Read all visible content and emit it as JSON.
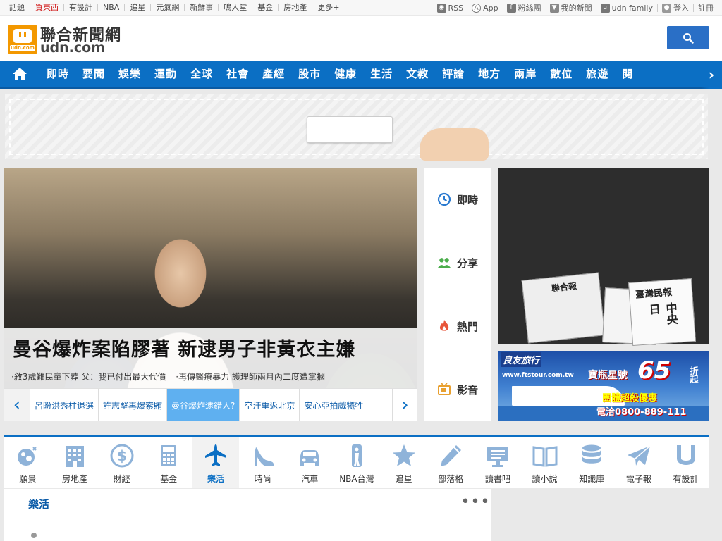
{
  "topbar": {
    "links": [
      "話題",
      "買東西",
      "有設計",
      "NBA",
      "追星",
      "元氣網",
      "新鮮事",
      "鳴人堂",
      "基金",
      "房地產",
      "更多+"
    ],
    "hot_index": 1,
    "tools": {
      "rss": "RSS",
      "app": "App",
      "fans": "粉絲團",
      "mynews": "我的新聞",
      "family": "udn family",
      "login": "登入",
      "register": "註冊"
    }
  },
  "header": {
    "logo_cn": "聯合新聞網",
    "logo_en": "udn.com",
    "logo_badge": "udn.com"
  },
  "nav": {
    "items": [
      "即時",
      "要聞",
      "娛樂",
      "運動",
      "全球",
      "社會",
      "產經",
      "股市",
      "健康",
      "生活",
      "文教",
      "評論",
      "地方",
      "兩岸",
      "數位",
      "旅遊",
      "閱"
    ]
  },
  "hero": {
    "title": "曼谷爆炸案陷膠著 新逮男子非黃衣主嫌",
    "sub1": "·敘3歲難民童下葬 父：我已付出最大代價",
    "sub2": "·再傳醫療暴力 護理師兩月內二度遭掌摑",
    "strip": [
      "呂盼洪秀柱退選",
      "許志堅再爆索賄",
      "曼谷爆炸逮錯人?",
      "空汙重返北京",
      "安心亞拍戲犧牲"
    ],
    "strip_active": 2
  },
  "sidetabs": [
    "即時",
    "分享",
    "熱門",
    "影音"
  ],
  "ads": {
    "newspaper_cn_1": "聯合報",
    "newspaper_cn_2": "臺灣民報",
    "newspaper_cn_3": "中央日",
    "travel_logo": "良友旅行",
    "travel_url": "www.ftstour.com.tw",
    "travel_ship": "寶瓶星號",
    "travel_discount": "65",
    "travel_discount_unit": "折起",
    "travel_promo": "團體超殺優惠",
    "travel_phone": "電洽0800-889-111"
  },
  "channels": {
    "items": [
      "願景",
      "房地產",
      "財經",
      "基金",
      "樂活",
      "時尚",
      "汽車",
      "NBA台灣",
      "追星",
      "部落格",
      "讀書吧",
      "讀小說",
      "知識庫",
      "電子報",
      "有設計"
    ],
    "active": 4
  },
  "panel": {
    "title": "樂活",
    "more": "•••"
  },
  "colors": {
    "brand_blue": "#0b6fc4",
    "logo_orange": "#f39800",
    "hot_red": "#cc0000",
    "icon_blue": "#2a7ad0"
  }
}
